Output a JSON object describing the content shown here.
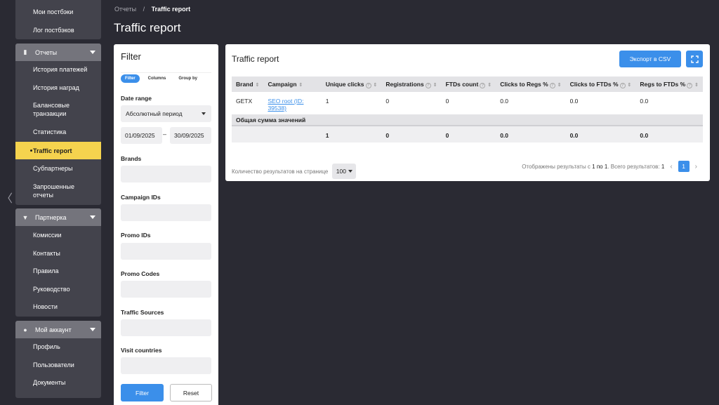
{
  "sidebar": {
    "top_items": [
      "Мои постбэки",
      "Лог постбэков"
    ],
    "groups": [
      {
        "title": "Отчеты",
        "icon": "clipboard-icon",
        "items": [
          "История платежей",
          "История наград",
          "Балансовые транзакции",
          "Статистика",
          "Traffic report",
          "Субпартнеры",
          "Запрошенные отчеты"
        ],
        "active_index": 4
      },
      {
        "title": "Партнерка",
        "icon": "funnel-icon",
        "items": [
          "Комиссии",
          "Контакты",
          "Правила",
          "Руководство",
          "Новости"
        ]
      },
      {
        "title": "Мой аккаунт",
        "icon": "user-icon",
        "items": [
          "Профиль",
          "Пользователи",
          "Документы"
        ]
      }
    ]
  },
  "breadcrumb": {
    "parent": "Отчеты",
    "separator": "/",
    "current": "Traffic report"
  },
  "page_title": "Traffic report",
  "filter": {
    "title": "Filter",
    "tabs": [
      "Filter",
      "Columns",
      "Group by"
    ],
    "date_range_label": "Date range",
    "date_mode": "Абсолютный период",
    "date_from": "01/09/2025",
    "date_dash": "–",
    "date_to": "30/09/2025",
    "fields": [
      "Brands",
      "Campaign IDs",
      "Promo IDs",
      "Promo Codes",
      "Traffic Sources",
      "Visit countries"
    ],
    "filter_button": "Filter",
    "reset_button": "Reset"
  },
  "report": {
    "title": "Traffic report",
    "export_button": "Экспорт в CSV",
    "columns": [
      "Brand",
      "Campaign",
      "Unique clicks",
      "Registrations",
      "FTDs count",
      "Clicks to Regs %",
      "Clicks to FTDs %",
      "Regs to FTDs %"
    ],
    "rows": [
      {
        "brand": "GETX",
        "campaign": "SEO root (ID: 39538)",
        "unique_clicks": "1",
        "registrations": "0",
        "ftds": "0",
        "c2r": "0.0",
        "c2f": "0.0",
        "r2f": "0.0"
      }
    ],
    "summary_label": "Общая сумма значений",
    "summary": {
      "unique_clicks": "1",
      "registrations": "0",
      "ftds": "0",
      "c2r": "0.0",
      "c2f": "0.0",
      "r2f": "0.0"
    },
    "per_page_label": "Количество результатов на странице",
    "per_page_value": "100",
    "results_prefix": "Отображены результаты с",
    "results_range": "1 по 1",
    "results_total_label": ". Всего результатов:",
    "results_total": "1",
    "current_page": "1"
  }
}
